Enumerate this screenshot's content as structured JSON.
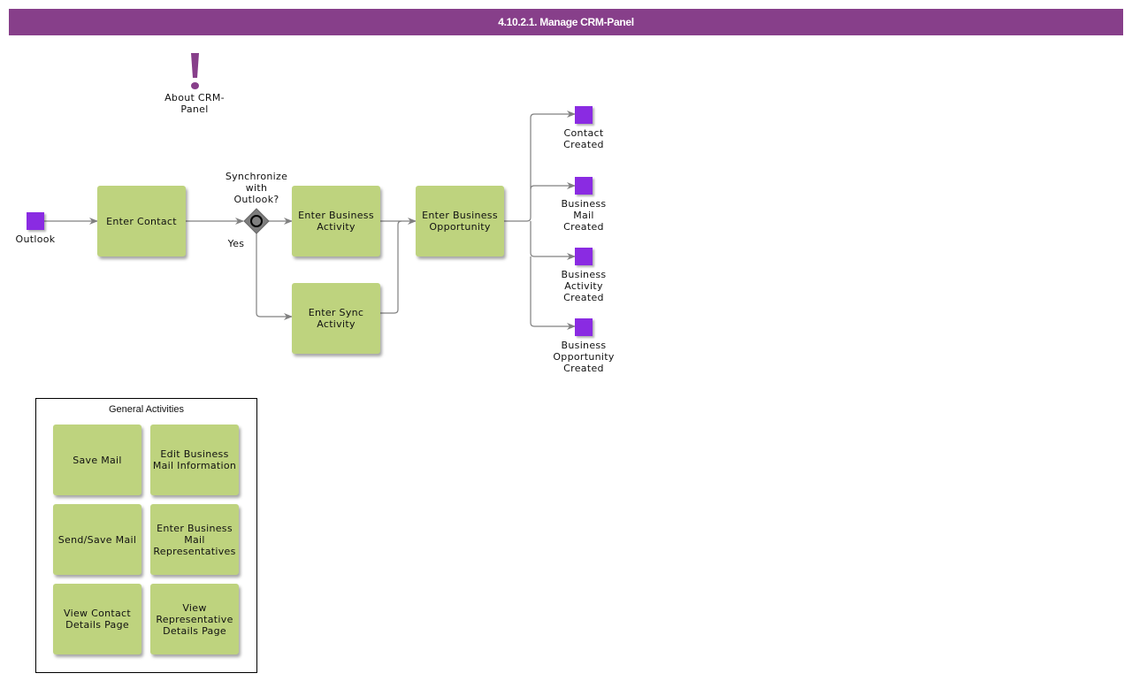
{
  "title": "4.10.2.1. Manage CRM-Panel",
  "annotation": {
    "label": "About CRM-\nPanel",
    "icon": "exclamation-icon"
  },
  "start_event": {
    "label": "Outlook"
  },
  "tasks": {
    "enter_contact": "Enter Contact",
    "enter_business_activity": "Enter Business Activity",
    "enter_sync_activity": "Enter Sync Activity",
    "enter_business_opportunity": "Enter Business Opportunity"
  },
  "gateway": {
    "question": "Synchronize\nwith\nOutlook?",
    "yes_label": "Yes"
  },
  "end_events": [
    {
      "label": "Contact\nCreated"
    },
    {
      "label": "Business\nMail\nCreated"
    },
    {
      "label": "Business\nActivity\nCreated"
    },
    {
      "label": "Business\nOpportunity\nCreated"
    }
  ],
  "general_activities": {
    "title": "General Activities",
    "items": [
      "Save Mail",
      "Edit Business Mail Information",
      "Send/Save Mail",
      "Enter Business Mail Representatives",
      "View Contact Details Page",
      "View Representative Details Page"
    ]
  },
  "colors": {
    "title_bar": "#873f8a",
    "task": "#bed37e",
    "event": "#8a2be2",
    "connector": "#808080"
  }
}
